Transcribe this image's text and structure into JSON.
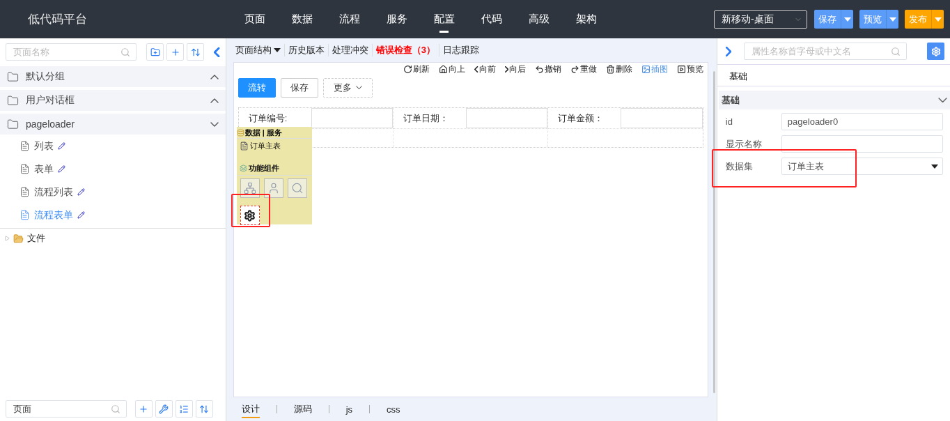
{
  "header": {
    "brand": "低代码平台",
    "nav": [
      {
        "label": "页面",
        "selected": false
      },
      {
        "label": "数据",
        "selected": false
      },
      {
        "label": "流程",
        "selected": false
      },
      {
        "label": "服务",
        "selected": false
      },
      {
        "label": "配置",
        "selected": true
      },
      {
        "label": "代码",
        "selected": false
      },
      {
        "label": "高级",
        "selected": false
      },
      {
        "label": "架构",
        "selected": false
      }
    ],
    "device": "新移动-桌面",
    "buttons": [
      {
        "label": "保存",
        "kind": "save"
      },
      {
        "label": "预览",
        "kind": "preview"
      },
      {
        "label": "发布",
        "kind": "publish"
      }
    ]
  },
  "left": {
    "search_placeholder": "页面名称",
    "groups": [
      {
        "name": "默认分组",
        "expanded": false
      },
      {
        "name": "用户对话框",
        "expanded": false
      },
      {
        "name": "pageloader",
        "expanded": true,
        "children": [
          {
            "name": "列表",
            "selected": false
          },
          {
            "name": "表单",
            "selected": false
          },
          {
            "name": "流程列表",
            "selected": false
          },
          {
            "name": "流程表单",
            "selected": true
          }
        ]
      }
    ],
    "file_tree": {
      "label": "文件",
      "expanded": false
    },
    "bottom_search": "页面"
  },
  "center": {
    "tabs": [
      {
        "label": "页面结构",
        "kind": "dropdown"
      },
      {
        "label": "历史版本",
        "kind": "plain"
      },
      {
        "label": "处理冲突",
        "kind": "plain"
      },
      {
        "label": "错误检查（3）",
        "kind": "error"
      },
      {
        "label": "日志跟踪",
        "kind": "plain"
      }
    ],
    "actions": [
      {
        "label": "刷新",
        "kind": "refresh",
        "selected": false
      },
      {
        "label": "向上",
        "kind": "up",
        "selected": false
      },
      {
        "label": "向前",
        "kind": "back",
        "selected": false
      },
      {
        "label": "向后",
        "kind": "forward",
        "selected": false
      },
      {
        "label": "撤销",
        "kind": "undo",
        "selected": false
      },
      {
        "label": "重做",
        "kind": "redo",
        "selected": false
      },
      {
        "label": "删除",
        "kind": "delete",
        "selected": false
      },
      {
        "label": "插图",
        "kind": "image",
        "selected": true
      },
      {
        "label": "预览",
        "kind": "preview",
        "selected": false
      }
    ],
    "form_buttons": [
      {
        "label": "流转",
        "kind": "primary"
      },
      {
        "label": "保存",
        "kind": "default"
      },
      {
        "label": "更多",
        "kind": "dropdown"
      }
    ],
    "fields": [
      {
        "label": "订单编号:"
      },
      {
        "label": "订单日期："
      },
      {
        "label": "订单金额："
      }
    ],
    "palette": {
      "title": "数据 | 服务",
      "datasets": [
        "订单主表"
      ],
      "section": "功能组件",
      "components": [
        {
          "kind": "flow",
          "highlighted": false
        },
        {
          "kind": "user",
          "highlighted": false
        },
        {
          "kind": "search",
          "highlighted": false
        },
        {
          "kind": "gear",
          "highlighted": true
        }
      ]
    },
    "bottom_tabs": [
      {
        "label": "设计",
        "selected": true
      },
      {
        "label": "源码",
        "selected": false
      },
      {
        "label": "js",
        "selected": false
      },
      {
        "label": "css",
        "selected": false
      }
    ]
  },
  "right": {
    "search_placeholder": "属性名称首字母或中文名",
    "tab": "基础",
    "section": {
      "title": "基础",
      "expanded": true
    },
    "props": [
      {
        "label": "id",
        "value": "pageloader0",
        "kind": "text",
        "highlighted": false
      },
      {
        "label": "显示名称",
        "kind": "text",
        "highlighted": false
      },
      {
        "label": "数据集",
        "value": "订单主表",
        "kind": "select",
        "highlighted": true
      }
    ]
  }
}
